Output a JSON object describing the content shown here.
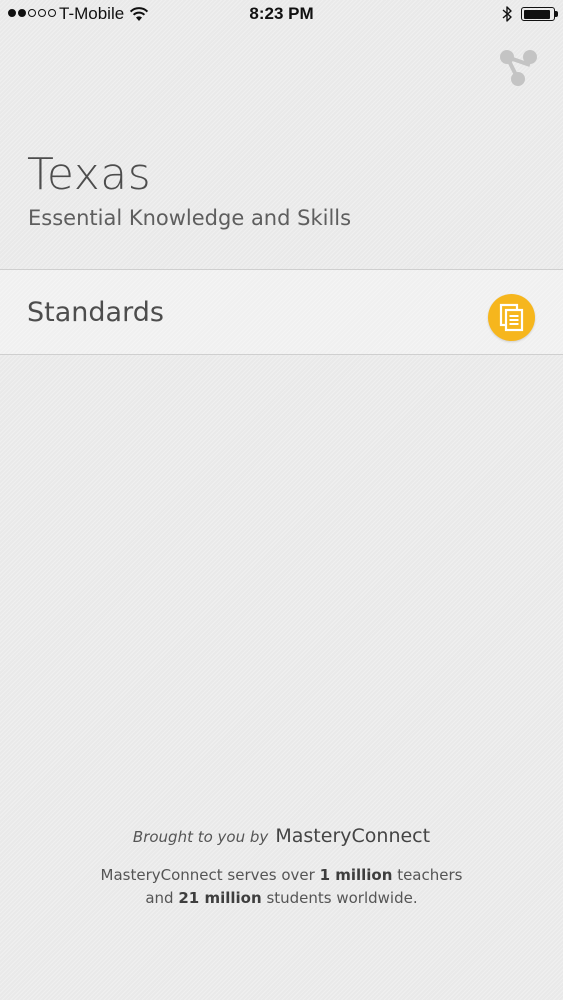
{
  "status_bar": {
    "carrier": "T-Mobile",
    "time": "8:23 PM",
    "signal_bars_filled": 2,
    "signal_bars_total": 5,
    "battery_level": 0.85,
    "icons": [
      "wifi-icon",
      "bluetooth-icon",
      "battery-icon"
    ]
  },
  "header": {
    "share_icon": "share-icon",
    "title": "Texas",
    "subtitle": "Essential Knowledge and Skills"
  },
  "list": {
    "items": [
      {
        "label": "Standards",
        "icon": "documents-icon",
        "icon_color": "#f6b61d"
      }
    ]
  },
  "footer": {
    "brought_by": "Brought to you by",
    "brand": "MasteryConnect",
    "line1_prefix": "MasteryConnect serves over",
    "line1_bold": "1 million",
    "line1_suffix": "teachers",
    "line2_prefix": "and",
    "line2_bold": "21 million",
    "line2_suffix": "students worldwide."
  },
  "colors": {
    "background": "#ececec",
    "accent": "#f6b61d",
    "text": "#4d4d4d",
    "divider": "#cfcfcf"
  }
}
